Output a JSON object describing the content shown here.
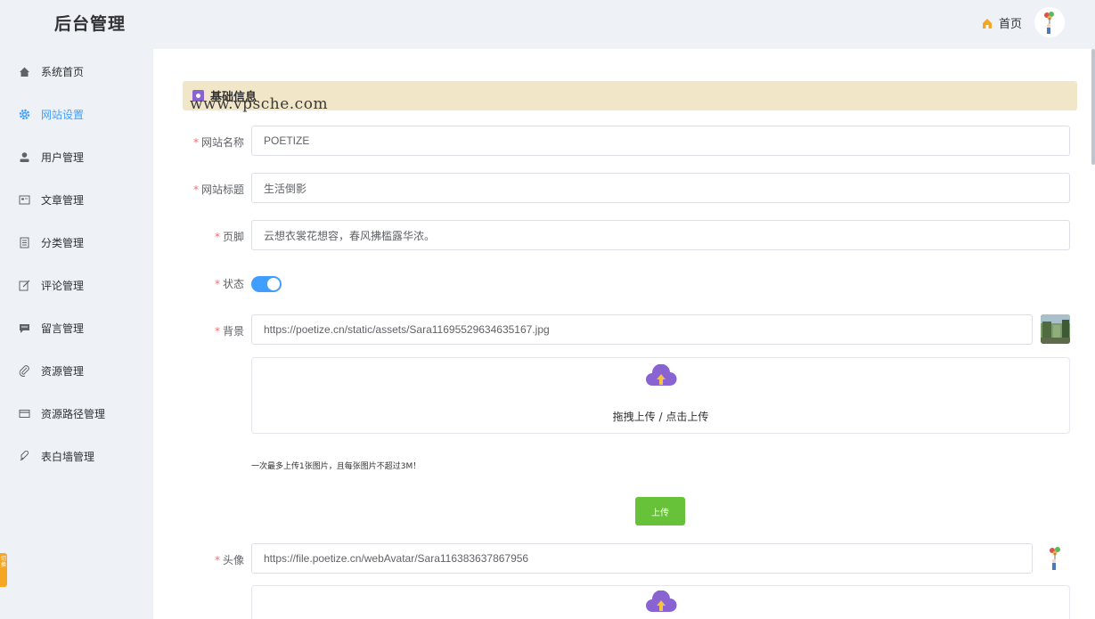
{
  "header": {
    "title": "后台管理",
    "home_label": "首页"
  },
  "sidebar": {
    "items": [
      {
        "label": "系统首页",
        "icon": "home-icon"
      },
      {
        "label": "网站设置",
        "icon": "gear-icon",
        "active": true
      },
      {
        "label": "用户管理",
        "icon": "user-icon"
      },
      {
        "label": "文章管理",
        "icon": "article-icon"
      },
      {
        "label": "分类管理",
        "icon": "category-icon"
      },
      {
        "label": "评论管理",
        "icon": "edit-icon"
      },
      {
        "label": "留言管理",
        "icon": "message-icon"
      },
      {
        "label": "资源管理",
        "icon": "paperclip-icon"
      },
      {
        "label": "资源路径管理",
        "icon": "card-icon"
      },
      {
        "label": "表白墙管理",
        "icon": "wall-icon"
      }
    ],
    "side_tab_text": "切换"
  },
  "section": {
    "title": "基础信息",
    "watermark": "www.vpsche.com"
  },
  "form": {
    "site_name_label": "网站名称",
    "site_name_value": "POETIZE",
    "site_title_label": "网站标题",
    "site_title_value": "生活倒影",
    "footer_label": "页脚",
    "footer_value": "云想衣裳花想容，春风拂槛露华浓。",
    "status_label": "状态",
    "status_on": true,
    "background_label": "背景",
    "background_value": "https://poetize.cn/static/assets/Sara11695529634635167.jpg",
    "upload_text": "拖拽上传 / 点击上传",
    "upload_tip": "一次最多上传1张图片，且每张图片不超过3M！",
    "upload_button": "上传",
    "avatar_label": "头像",
    "avatar_value": "https://file.poetize.cn/webAvatar/Sara116383637867956"
  },
  "colors": {
    "accent": "#409eff",
    "section_bg": "#f2e6c9",
    "upload_icon": "#8a63d2",
    "upload_button": "#67c23a",
    "required": "#f56c6c"
  }
}
